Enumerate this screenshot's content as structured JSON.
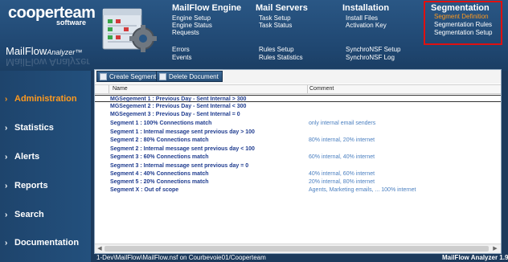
{
  "brand": {
    "logo": "cooperteam",
    "logo_sub": "software",
    "product_main": "MailFlow",
    "product_sub": "Analyzer™",
    "accent": "#ff9a1e",
    "highlight_box": "#e01010"
  },
  "top_menu": {
    "mailflow_engine": {
      "title": "MailFlow Engine",
      "items": [
        "Engine Setup",
        "Engine Status",
        "Requests",
        "Errors",
        "Events"
      ]
    },
    "mail_servers": {
      "title": "Mail Servers",
      "items": [
        "Task Setup",
        "Task Status",
        "Rules Setup",
        "Rules Statistics"
      ]
    },
    "installation": {
      "title": "Installation",
      "items": [
        "Install Files",
        "Activation Key",
        "SynchroNSF Setup",
        "SynchroNSF Log"
      ]
    },
    "segmentation": {
      "title": "Segmentation",
      "items": [
        "Segment Definition",
        "Segmentation Rules",
        "Segmentation Setup"
      ],
      "active_item": "Segment Definition"
    }
  },
  "left_nav": [
    {
      "label": "Administration",
      "active": true
    },
    {
      "label": "Statistics",
      "active": false
    },
    {
      "label": "Alerts",
      "active": false
    },
    {
      "label": "Reports",
      "active": false
    },
    {
      "label": "Search",
      "active": false
    },
    {
      "label": "Documentation",
      "active": false
    }
  ],
  "toolbar": {
    "create_label": "Create Segment",
    "delete_label": "Delete Document"
  },
  "table": {
    "columns": [
      "Name",
      "Comment"
    ],
    "rows": [
      {
        "name": "MGSegement 1 : Previous Day - Sent Internal > 300",
        "comment": ""
      },
      {
        "name": "MGSegement 2 : Previous Day - Sent Internal < 300",
        "comment": ""
      },
      {
        "name": "MGSegement 3 : Previous Day - Sent Internal = 0",
        "comment": ""
      },
      {
        "name": "Segment 1 : 100% Connections match",
        "comment": "only internal email senders"
      },
      {
        "name": "Segment 1 : Internal message sent previous day > 100",
        "comment": ""
      },
      {
        "name": "Segment 2 : 80% Connections match",
        "comment": "80% internal, 20% internet"
      },
      {
        "name": "Segment 2 : Internal message sent previous day < 100",
        "comment": ""
      },
      {
        "name": "Segment 3 : 60% Connections match",
        "comment": "60% internal, 40% internet"
      },
      {
        "name": "Segment 3 : Internal message sent previous day = 0",
        "comment": ""
      },
      {
        "name": "Segment 4 : 40% Connections match",
        "comment": "40% internal, 60% internet"
      },
      {
        "name": "Segment 5 : 20% Connections match",
        "comment": "20% internal, 80% internet"
      },
      {
        "name": "Segment X : Out of scope",
        "comment": "Agents, Marketing emails, ... 100% internet"
      }
    ]
  },
  "status": {
    "path": "1-Dev\\MailFlow\\MailFlow.nsf on Courbevoie01/Cooperteam",
    "version": "MailFlow Analyzer 1.9"
  }
}
